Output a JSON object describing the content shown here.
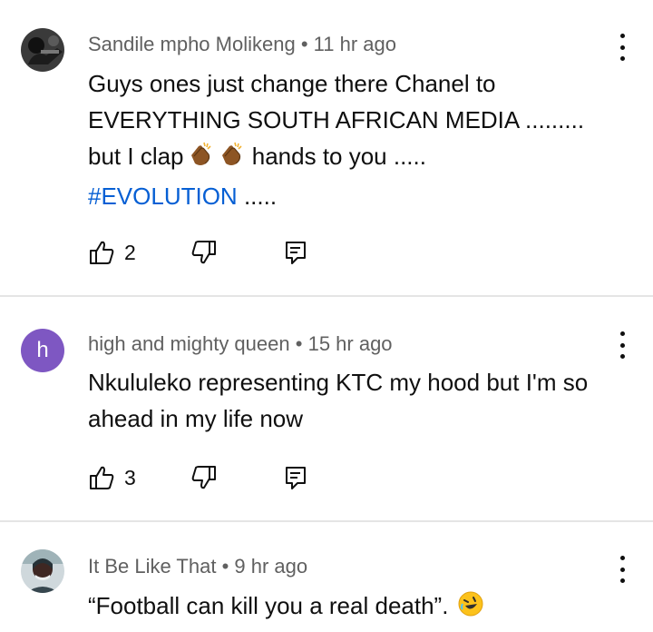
{
  "comments": [
    {
      "author": "Sandile mpho Molikeng",
      "time": "11 hr ago",
      "text_line1": "Guys ones just change there Chanel to",
      "text_line2": "EVERYTHING SOUTH AFRICAN MEDIA .........",
      "text_line3a": "but I clap",
      "text_line3b": "hands to you .....",
      "hashtag": "#EVOLUTION",
      "text_line4b": ".....",
      "likes": "2",
      "icons": [
        "like-icon",
        "dislike-icon",
        "reply-icon",
        "more-icon"
      ]
    },
    {
      "author": "high and mighty queen",
      "avatar_letter": "h",
      "avatar_color": "#7e57c2",
      "time": "15 hr ago",
      "text_line1": "Nkululeko representing KTC my hood but I'm so",
      "text_line2": "ahead in my life now",
      "likes": "3",
      "icons": [
        "like-icon",
        "dislike-icon",
        "reply-icon",
        "more-icon"
      ]
    },
    {
      "author": "It Be Like That",
      "time": "9 hr ago",
      "text_line1": "“Football can kill you a real death”.",
      "icons": [
        "more-icon",
        "rolling-laughing-emoji"
      ]
    }
  ],
  "colors": {
    "hashtag": "#065fd4",
    "meta": "#606060",
    "separator": "#e5e5e5"
  }
}
